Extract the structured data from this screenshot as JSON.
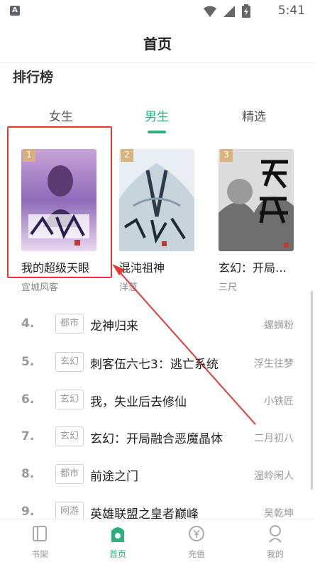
{
  "status_bar": {
    "time": "5:41",
    "app_glyph": "A"
  },
  "header": {
    "title": "首页"
  },
  "section": {
    "title": "排行榜"
  },
  "tabs": [
    {
      "label": "女生",
      "active": false
    },
    {
      "label": "男生",
      "active": true
    },
    {
      "label": "精选",
      "active": false
    }
  ],
  "top3": [
    {
      "rank": "1",
      "title": "我的超级天眼",
      "author": "宜城风客"
    },
    {
      "rank": "2",
      "title": "混沌祖神",
      "author": "洋葱"
    },
    {
      "rank": "3",
      "title": "玄幻：开局…",
      "author": "三尺"
    }
  ],
  "ranking_list": [
    {
      "rank": "4.",
      "category": "都市",
      "title": "龙神归来",
      "author": "螺蛳粉"
    },
    {
      "rank": "5.",
      "category": "玄幻",
      "title": "刺客伍六七3：逃亡系统",
      "author": "浮生往梦"
    },
    {
      "rank": "6.",
      "category": "玄幻",
      "title": "我，失业后去修仙",
      "author": "小铁匠"
    },
    {
      "rank": "7.",
      "category": "玄幻",
      "title": "玄幻：开局融合恶魔晶体",
      "author": "二月初八"
    },
    {
      "rank": "8.",
      "category": "都市",
      "title": "前途之门",
      "author": "温岭闲人"
    },
    {
      "rank": "9.",
      "category": "网游",
      "title": "英雄联盟之皇者巅峰",
      "author": "吴乾坤"
    }
  ],
  "bottom_nav": [
    {
      "label": "书架",
      "icon": "bookshelf-icon",
      "active": false
    },
    {
      "label": "首页",
      "icon": "home-icon",
      "active": true
    },
    {
      "label": "充值",
      "icon": "recharge-icon",
      "active": false
    },
    {
      "label": "我的",
      "icon": "profile-icon",
      "active": false
    }
  ],
  "colors": {
    "accent": "#2bb07f",
    "highlight": "#e53935",
    "badge": "#d7b27a"
  }
}
